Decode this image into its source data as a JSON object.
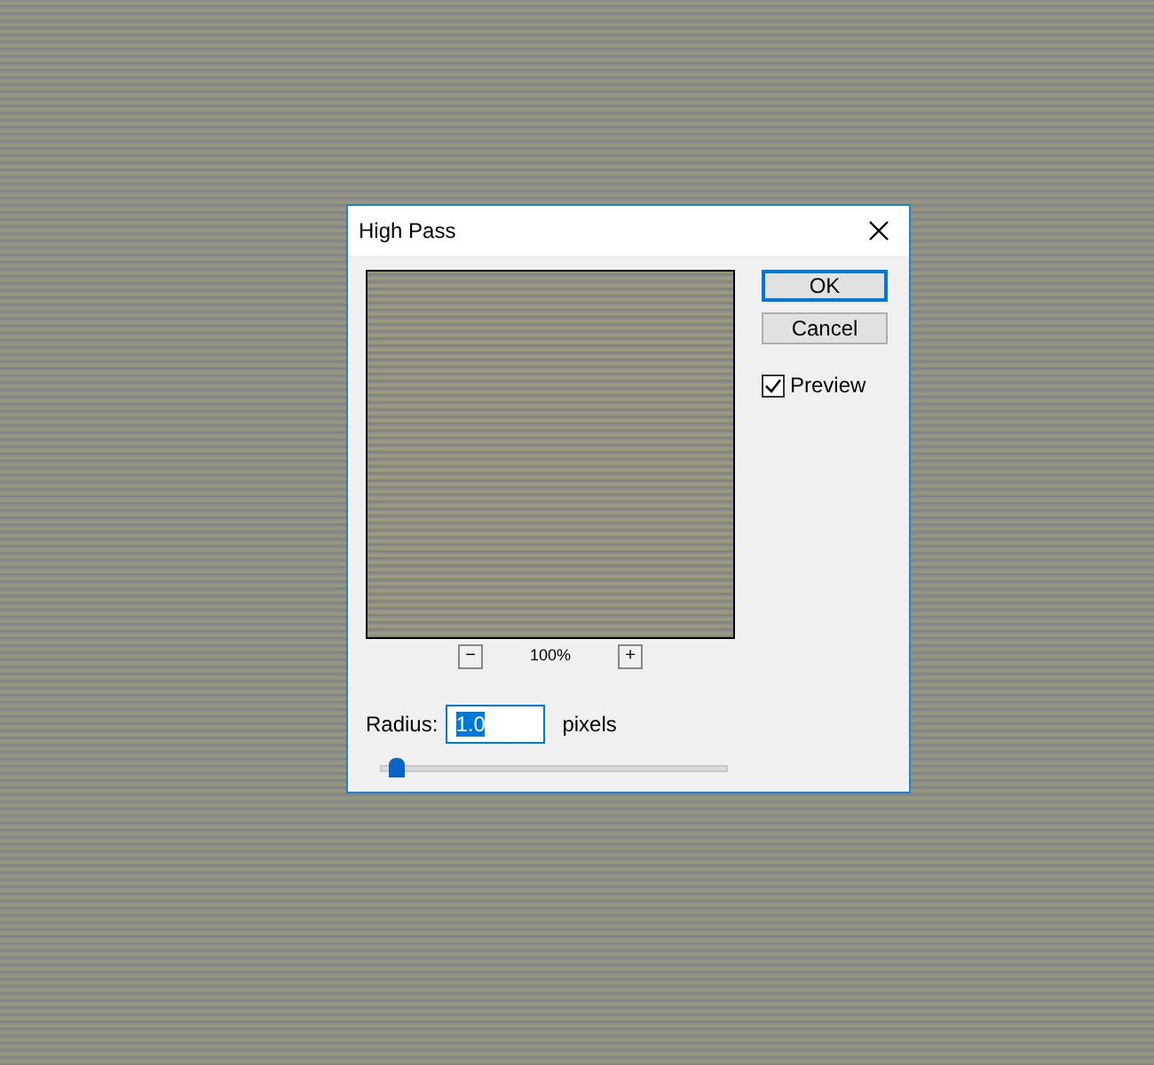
{
  "window": {
    "title": "High Pass"
  },
  "preview": {
    "zoom": "100%",
    "zoom_out": "−",
    "zoom_in": "+"
  },
  "buttons": [
    {
      "label": "OK",
      "default": true
    },
    {
      "label": "Cancel",
      "default": false
    }
  ],
  "preview_checkbox": {
    "label": "Preview",
    "checked": true
  },
  "radius": {
    "label": "Radius:",
    "value": "1.0",
    "unit": "pixels",
    "level": 0.04
  }
}
